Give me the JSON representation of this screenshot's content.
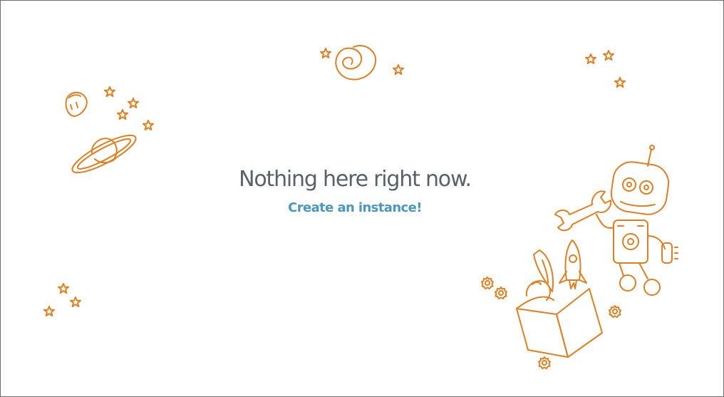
{
  "empty_state": {
    "headline": "Nothing here right now.",
    "cta_label": "Create an instance!"
  },
  "colors": {
    "illustration": "#e07f22",
    "headline": "#58606a",
    "link": "#4b97c2",
    "border": "#6f6f6f"
  },
  "icons": [
    "star-icon",
    "spiral-galaxy-icon",
    "ringed-planet-icon",
    "moon-rock-icon",
    "robot-icon",
    "wrench-icon",
    "rocket-icon",
    "open-box-icon",
    "gear-icon"
  ]
}
